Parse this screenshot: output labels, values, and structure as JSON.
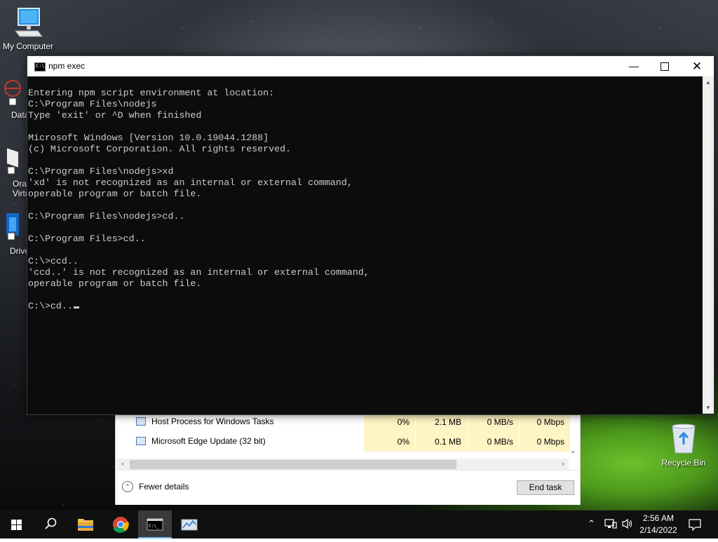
{
  "desktop": {
    "icons": [
      {
        "label": "My Computer"
      },
      {
        "label": "DataW"
      },
      {
        "label": "Oracl Virtu"
      },
      {
        "label": "Drive"
      },
      {
        "label": "Recycle Bin"
      }
    ]
  },
  "console_window": {
    "title": "npm exec",
    "lines": [
      "Entering npm script environment at location:",
      "C:\\Program Files\\nodejs",
      "Type 'exit' or ^D when finished",
      "",
      "Microsoft Windows [Version 10.0.19044.1288]",
      "(c) Microsoft Corporation. All rights reserved.",
      "",
      "C:\\Program Files\\nodejs>xd",
      "'xd' is not recognized as an internal or external command,",
      "operable program or batch file.",
      "",
      "C:\\Program Files\\nodejs>cd..",
      "",
      "C:\\Program Files>cd..",
      "",
      "C:\\>ccd..",
      "'ccd..' is not recognized as an internal or external command,",
      "operable program or batch file.",
      "",
      "C:\\>cd.."
    ]
  },
  "task_manager": {
    "rows": [
      {
        "name": "Host Process for Windows Tasks",
        "cpu": "0%",
        "memory": "2.1 MB",
        "disk": "0 MB/s",
        "network": "0 Mbps"
      },
      {
        "name": "Microsoft Edge Update (32 bit)",
        "cpu": "0%",
        "memory": "0.1 MB",
        "disk": "0 MB/s",
        "network": "0 Mbps"
      }
    ],
    "fewer_details": "Fewer details",
    "end_task": "End task"
  },
  "taskbar": {
    "time": "2:56 AM",
    "date": "2/14/2022",
    "apps": [
      "start",
      "search",
      "file-explorer",
      "chrome",
      "command-prompt",
      "network-tool"
    ]
  },
  "colors": {
    "console_bg": "#0c0c0c",
    "console_text": "#cccccc",
    "taskbar_bg": "#101010",
    "highlight_cell": "#fff4c4"
  }
}
